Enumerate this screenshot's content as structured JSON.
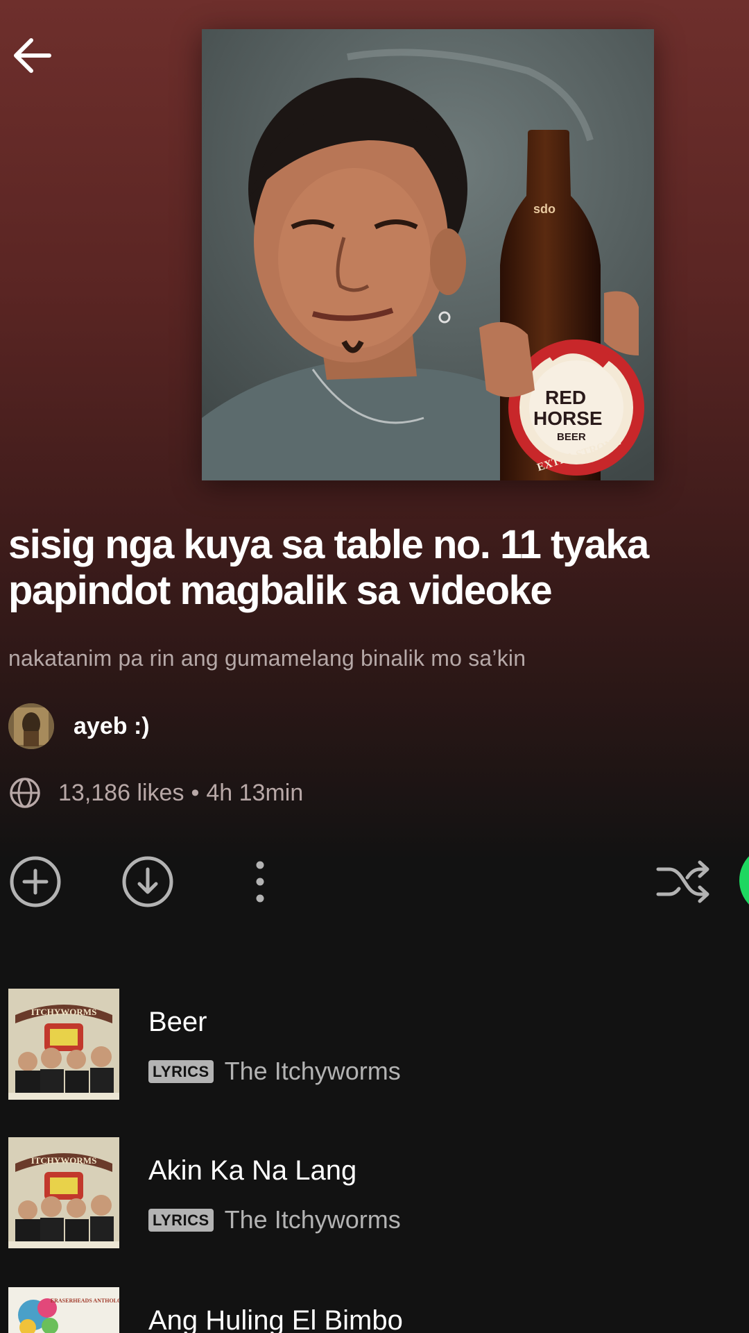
{
  "header": {
    "back_icon": "arrow-left-icon"
  },
  "playlist": {
    "cover_alt": "Playlist cover: man holding a Red Horse beer bottle",
    "cover_bottle_label": [
      "RED",
      "HORSE",
      "BEER",
      "EXTRA STRONG"
    ],
    "title": "sisig nga kuya sa table no. 11 tyaka papindot magbalik sa videoke",
    "description": "nakatanim pa rin ang gumamelang binalik mo sa’kin",
    "owner": {
      "name": "ayeb :)"
    },
    "likes": "13,186 likes",
    "separator": "•",
    "duration": "4h 13min"
  },
  "actions": {
    "add_icon": "plus-circle-icon",
    "download_icon": "download-circle-icon",
    "more_icon": "more-vertical-icon",
    "shuffle_icon": "shuffle-icon",
    "play_color": "#1ed760"
  },
  "tracks": [
    {
      "title": "Beer",
      "badge": "LYRICS",
      "artist": "The Itchyworms",
      "art_label": "ITCHYWORMS"
    },
    {
      "title": "Akin Ka Na Lang",
      "badge": "LYRICS",
      "artist": "The Itchyworms",
      "art_label": "ITCHYWORMS"
    },
    {
      "title": "Ang Huling El Bimbo",
      "art_label": "ERASERHEADS ANTHOLOGY"
    }
  ],
  "colors": {
    "header_gradient_top": "#6e2f2c",
    "background": "#121212",
    "secondary_text": "#b3b3b3",
    "accent": "#1ed760"
  }
}
